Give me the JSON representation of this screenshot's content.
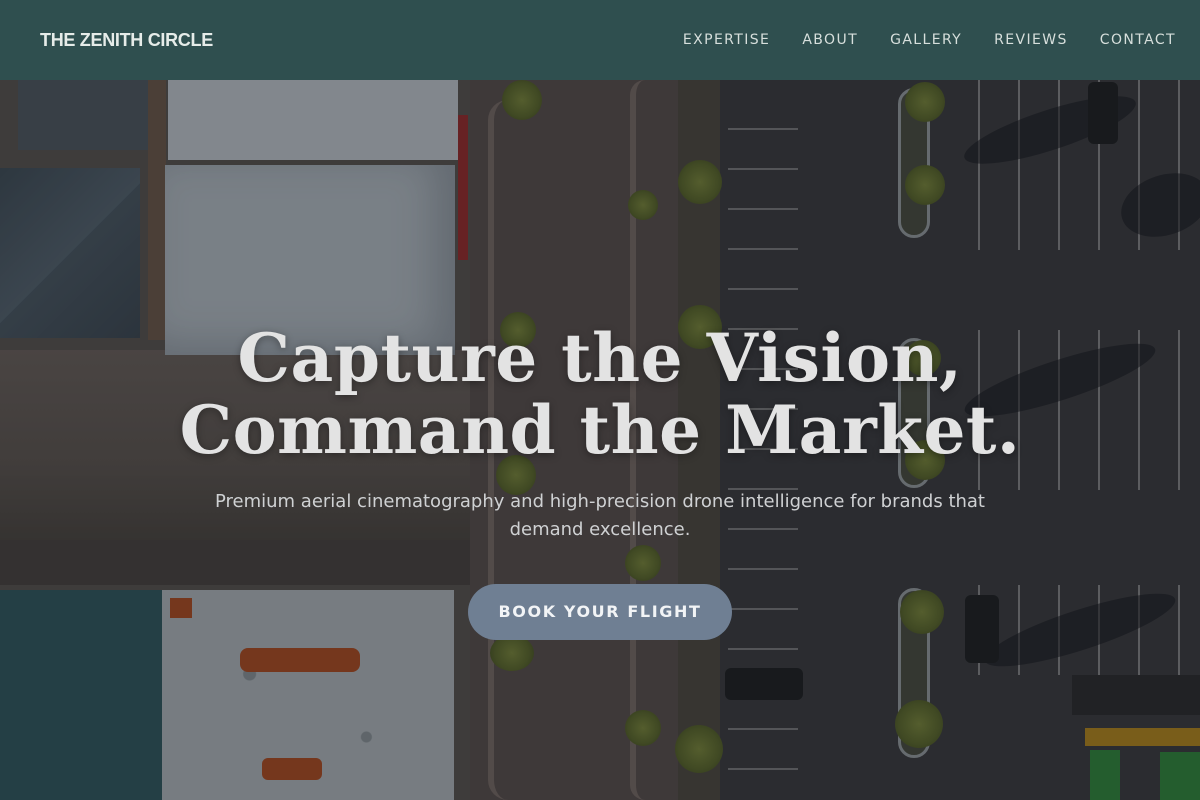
{
  "nav": {
    "brand": "THE ZENITH CIRCLE",
    "links": [
      "EXPERTISE",
      "ABOUT",
      "GALLERY",
      "REVIEWS",
      "CONTACT"
    ]
  },
  "hero": {
    "headline_line1": "Capture the Vision,",
    "headline_line2": "Command the Market.",
    "subtitle": "Premium aerial cinematography and high-precision drone intelligence for brands that demand excellence.",
    "cta_label": "BOOK YOUR FLIGHT"
  },
  "colors": {
    "nav_bg": "#2f4f4f",
    "cta_bg": "#6f7f93",
    "headline": "#e3e3e3"
  }
}
